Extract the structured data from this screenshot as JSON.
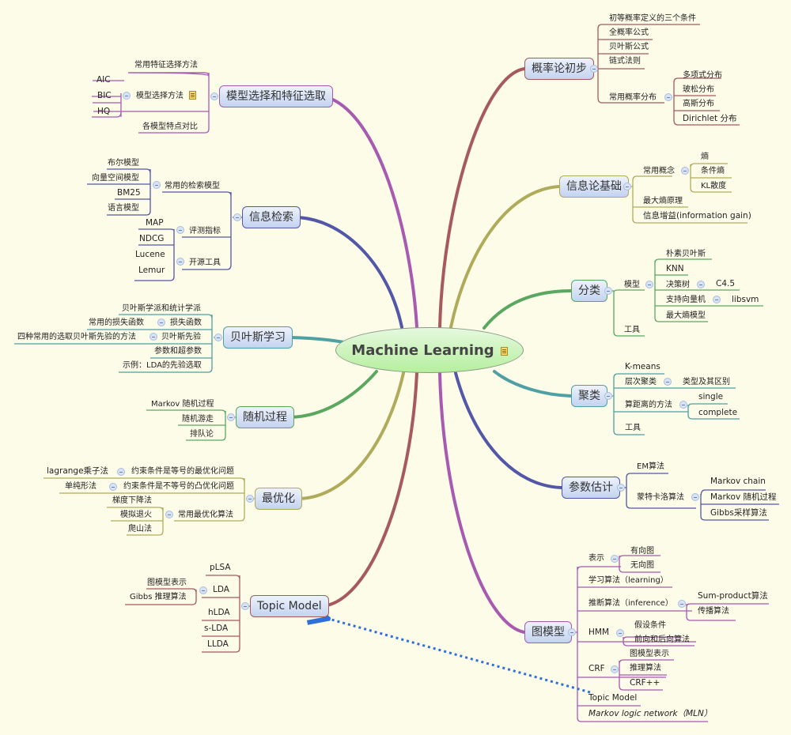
{
  "central": {
    "title": "Machine Learning",
    "icon": "note-icon"
  },
  "colors": {
    "background": "#fdfce9",
    "arrow": "#2f6fd9",
    "purple": "#a85ab0",
    "navy": "#5357a8",
    "teal": "#4fa0a2",
    "green": "#5aa85f",
    "olive": "#b0ab5a",
    "maroon": "#a65a5e"
  },
  "topics": {
    "model_selection": {
      "title": "模型选择和特征选取",
      "children": [
        "常用特征选择方法",
        "模型选择方法",
        "各模型特点对比"
      ],
      "model_methods": [
        "AIC",
        "BIC",
        "HQ"
      ]
    },
    "info_retrieval": {
      "title": "信息检索",
      "children": [
        "常用的检索模型",
        "评测指标",
        "开源工具"
      ],
      "retrieval_models": [
        "布尔模型",
        "向量空间模型",
        "BM25",
        "语言模型"
      ],
      "metrics": [
        "MAP",
        "NDCG"
      ],
      "tools": [
        "Lucene",
        "Lemur"
      ]
    },
    "bayes": {
      "title": "贝叶斯学习",
      "children": [
        "贝叶斯学派和统计学派",
        "损失函数",
        "贝叶斯先验",
        "参数和超参数",
        "示例：LDA的先验选取"
      ],
      "loss_sub": "常用的损失函数",
      "prior_sub": "四种常用的选取贝叶斯先验的方法"
    },
    "stochastic": {
      "title": "随机过程",
      "children": [
        "Markov 随机过程",
        "随机游走",
        "排队论"
      ]
    },
    "optimization": {
      "title": "最优化",
      "children": [
        "约束条件是等号的最优化问题",
        "约束条件是不等号的凸优化问题",
        "常用最优化算法"
      ],
      "eq_sub": "lagrange乘子法",
      "ineq_sub": "单纯形法",
      "algorithms": [
        "梯度下降法",
        "模拟退火",
        "爬山法"
      ]
    },
    "topic_model": {
      "title": "Topic Model",
      "children": [
        "pLSA",
        "LDA",
        "hLDA",
        "s-LDA",
        "LLDA"
      ],
      "lda_sub": [
        "图模型表示",
        "Gibbs 推理算法"
      ]
    },
    "probability": {
      "title": "概率论初步",
      "children": [
        "初等概率定义的三个条件",
        "全概率公式",
        "贝叶斯公式",
        "链式法则",
        "常用概率分布"
      ],
      "distributions": [
        "多项式分布",
        "玻松分布",
        "高斯分布",
        "Dirichlet 分布"
      ]
    },
    "info_theory": {
      "title": "信息论基础",
      "children": [
        "常用概念",
        "最大熵原理",
        "信息增益(information gain)"
      ],
      "concepts": [
        "熵",
        "条件熵",
        "KL散度"
      ]
    },
    "classification": {
      "title": "分类",
      "children": [
        "模型",
        "工具"
      ],
      "models": [
        "朴素贝叶斯",
        "KNN",
        "决策树",
        "支持向量机",
        "最大熵模型"
      ],
      "tree_sub": "C4.5",
      "svm_sub": "libsvm"
    },
    "clustering": {
      "title": "聚类",
      "children": [
        "K-means",
        "层次聚类",
        "算距离的方法",
        "工具"
      ],
      "hier_sub": "类型及其区别",
      "dist_sub": [
        "single",
        "complete"
      ]
    },
    "param_estimation": {
      "title": "参数估计",
      "children": [
        "EM算法",
        "蒙特卡洛算法"
      ],
      "mc_sub": [
        "Markov chain",
        "Markov 随机过程",
        "Gibbs采样算法"
      ]
    },
    "graphical": {
      "title": "图模型",
      "children": [
        "表示",
        "学习算法（learning）",
        "推断算法（inference）",
        "HMM",
        "CRF",
        "Topic Model",
        "Markov logic network（MLN）"
      ],
      "repr_sub": [
        "有向图",
        "无向图"
      ],
      "infer_sub": [
        "Sum-product算法",
        "传播算法"
      ],
      "hmm_sub": [
        "假设条件",
        "前向和后向算法"
      ],
      "crf_sub": [
        "图模型表示",
        "推理算法",
        "CRF++"
      ]
    }
  }
}
